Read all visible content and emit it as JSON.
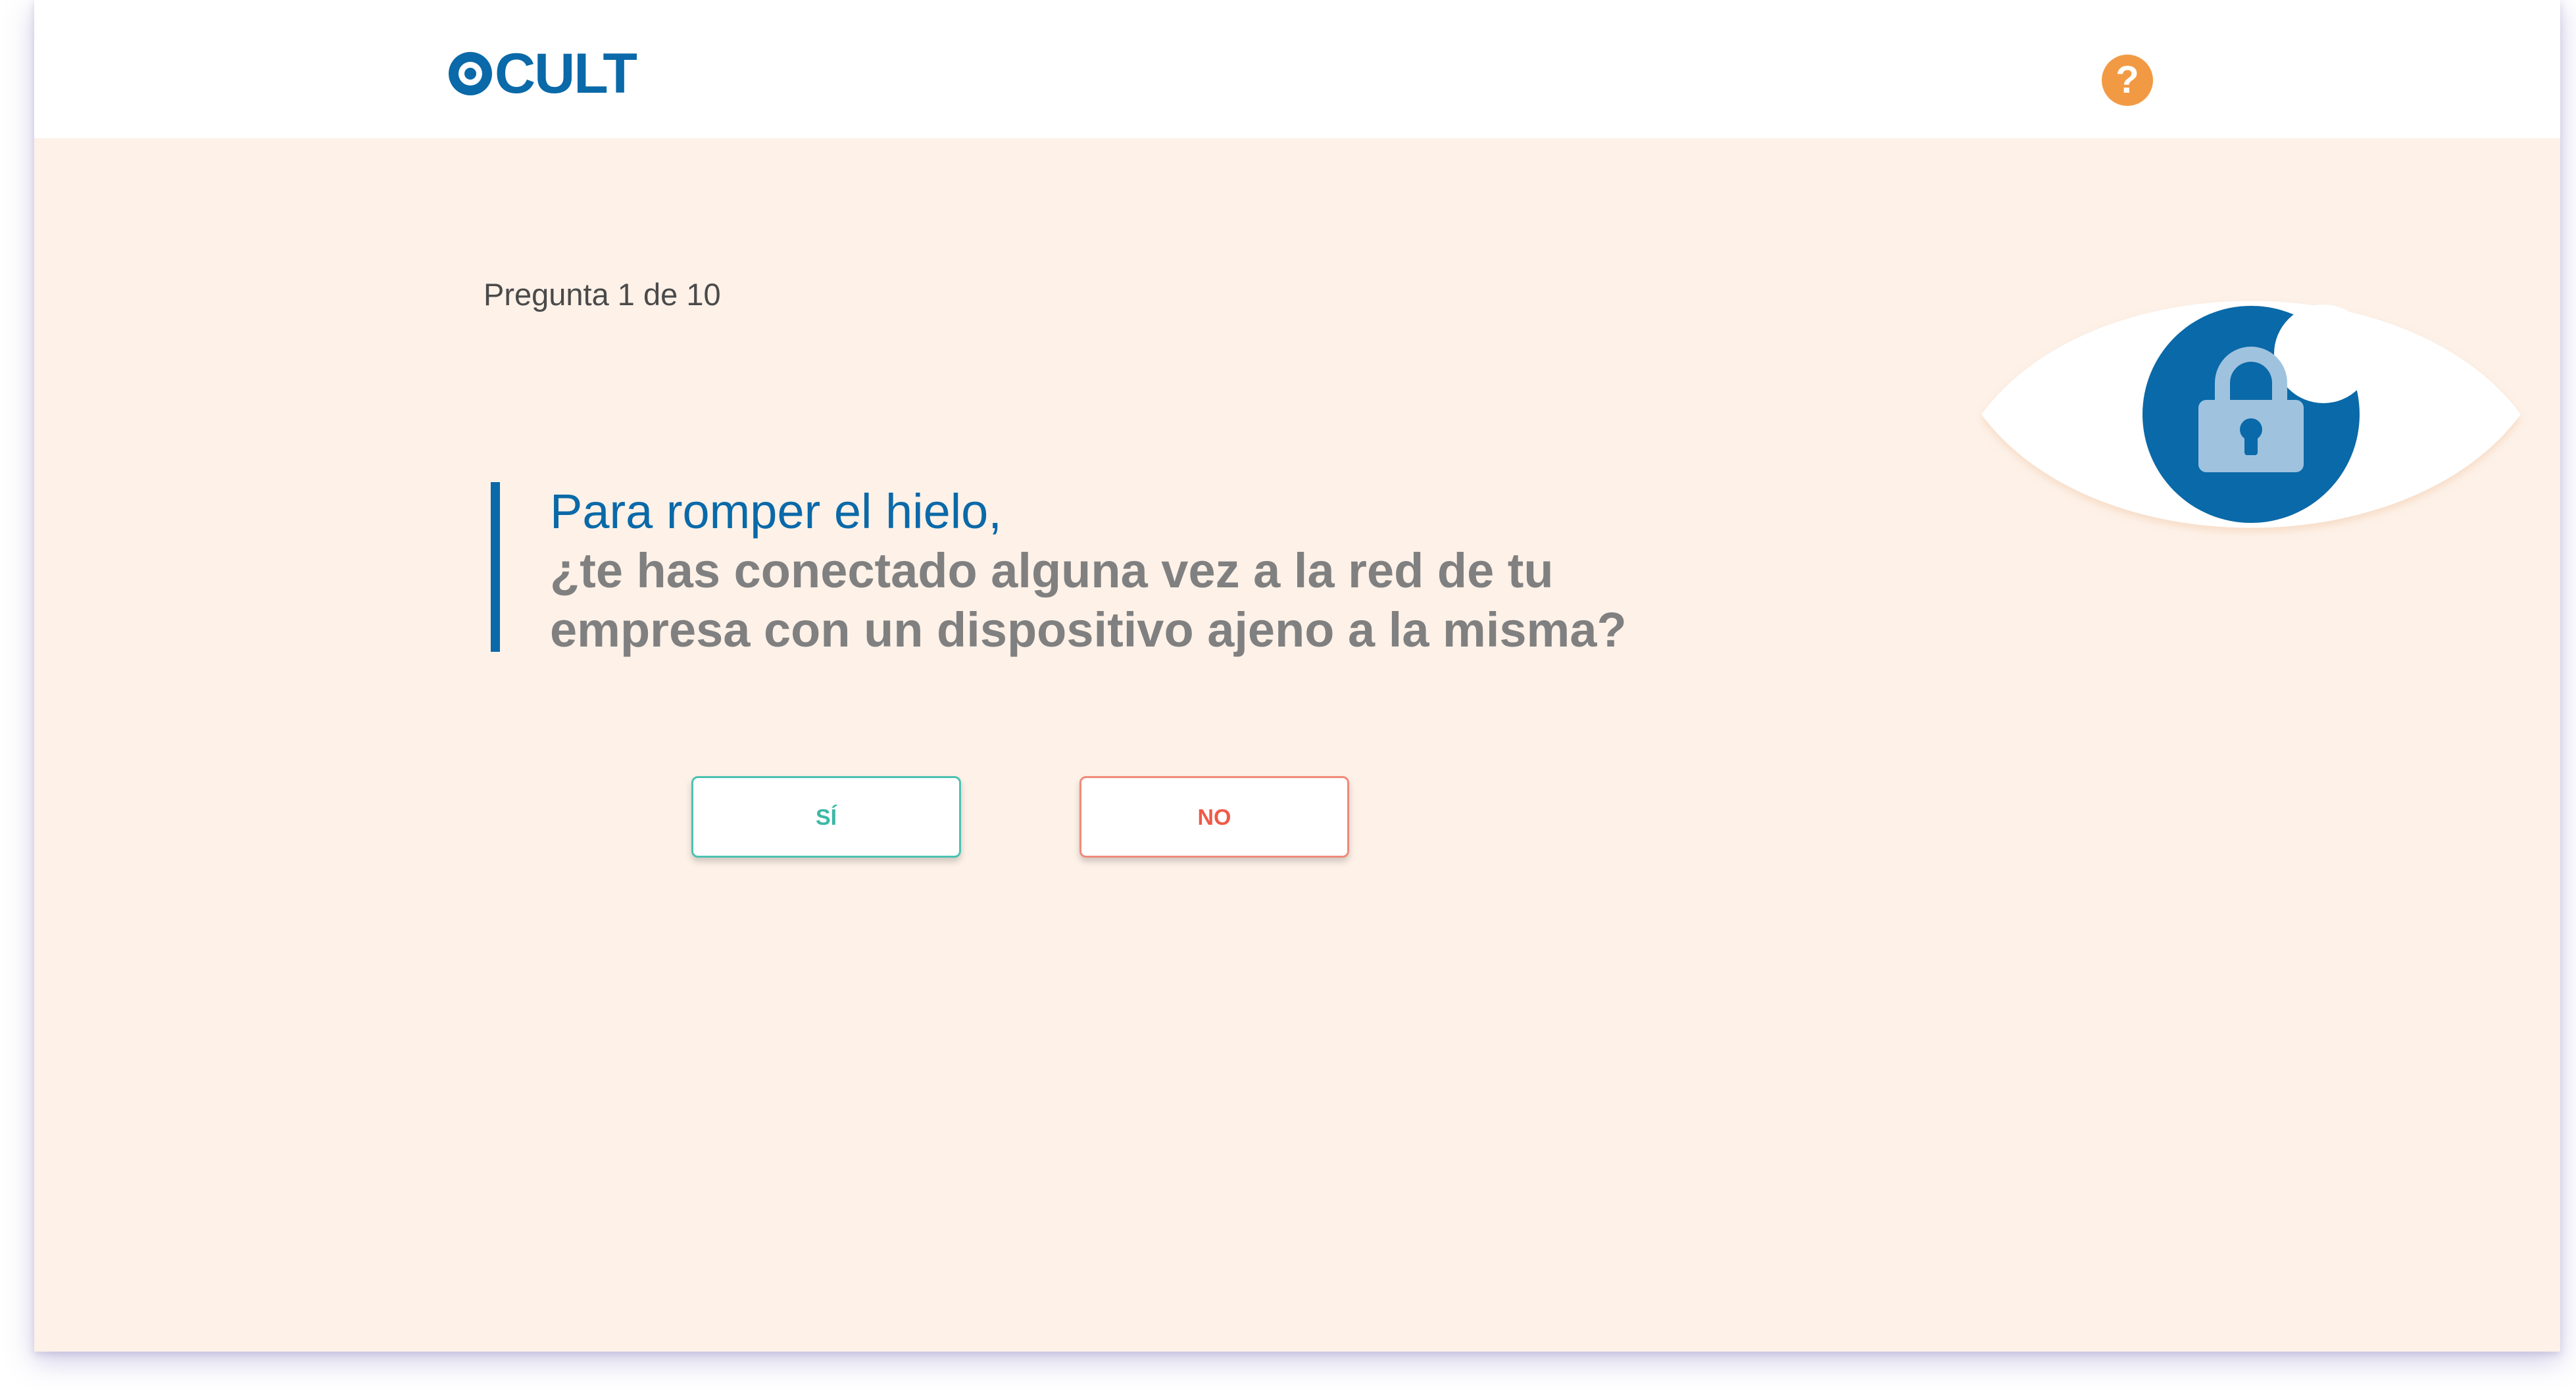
{
  "header": {
    "logo_text": "CULT",
    "help_label": "?"
  },
  "quiz": {
    "counter": "Pregunta 1 de 10",
    "question_lead": "Para romper el hielo,",
    "question_main": "¿te has conectado alguna vez a la red de tu empresa con un dispositivo ajeno a la misma?",
    "answers": {
      "yes": "SÍ",
      "no": "NO"
    }
  },
  "colors": {
    "brand_blue": "#0a69a8",
    "background": "#fdf1e8",
    "help_orange": "#f29a43",
    "yes_teal": "#3cb8a6",
    "no_red": "#ee5b49"
  },
  "icons": {
    "logo": "eye-logo-icon",
    "help": "question-mark-icon",
    "illustration": "eye-lock-icon"
  }
}
